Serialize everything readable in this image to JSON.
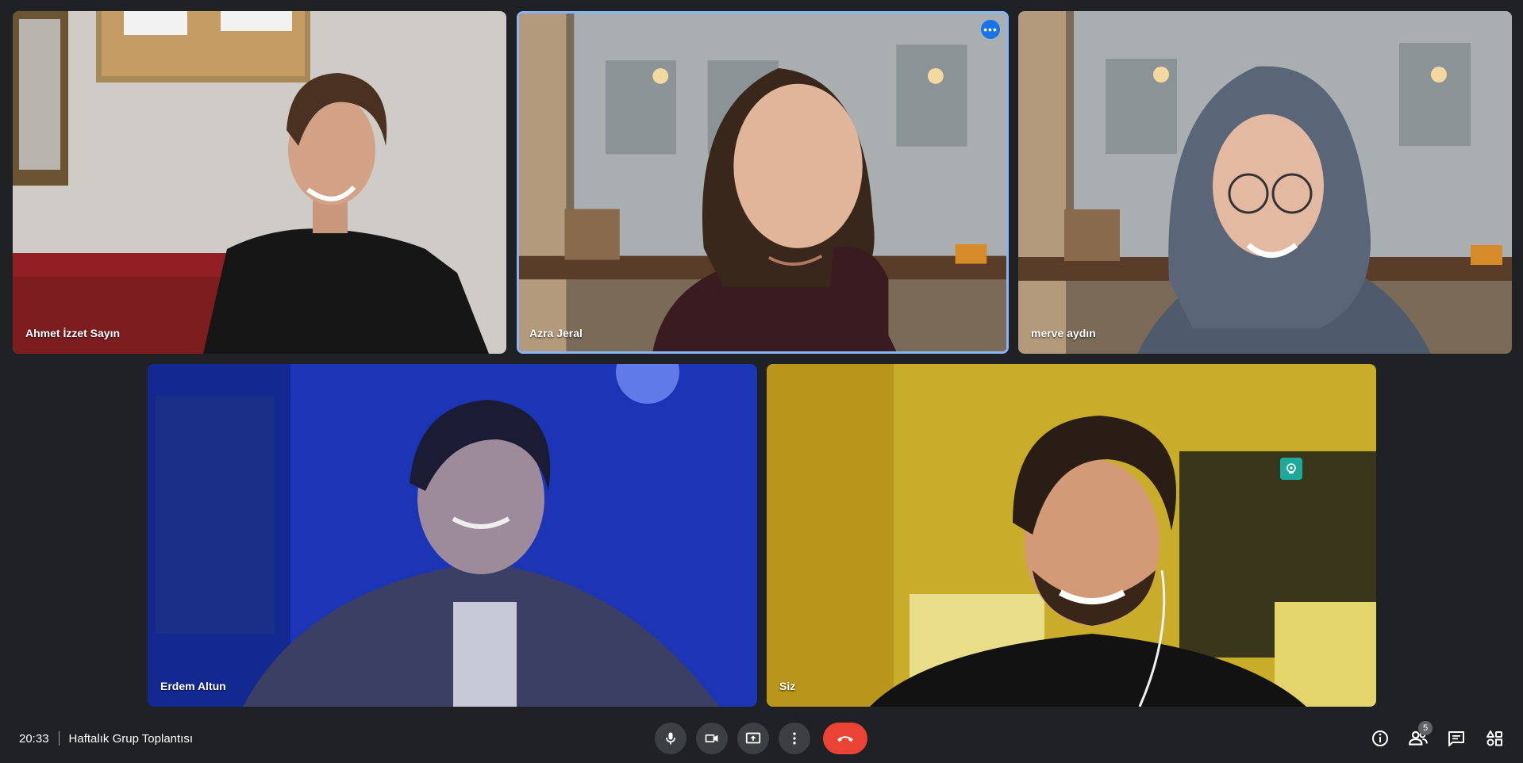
{
  "meeting": {
    "time": "20:33",
    "title": "Haftalık Grup Toplantısı"
  },
  "participants": [
    {
      "name": "Ahmet İzzet Sayın",
      "background": "room-wall"
    },
    {
      "name": "Azra Jeral",
      "background": "cafe-window-rain",
      "active_speaker": true
    },
    {
      "name": "merve aydın",
      "background": "cafe-window-rain"
    },
    {
      "name": "Erdem Altun",
      "background": "blue-lit-room"
    },
    {
      "name": "Siz",
      "background": "yellow-lit-room",
      "self": true
    }
  ],
  "icons": {
    "tile_more": "more-horizontal-icon",
    "effects": "visual-effects-icon",
    "mic": "microphone-icon",
    "camera": "camera-icon",
    "present": "present-screen-icon",
    "more": "more-vert-icon",
    "end_call": "end-call-icon",
    "info": "info-icon",
    "people": "people-icon",
    "chat": "chat-icon",
    "activities": "activities-icon"
  },
  "toolbar": {
    "people_count": "5"
  },
  "colors": {
    "background": "#202124",
    "control": "#3c4043",
    "end_call": "#ea4335",
    "active_border": "#8ab4f8",
    "accent_blue": "#1a73e8",
    "effect_badge": "#1ea99c"
  }
}
